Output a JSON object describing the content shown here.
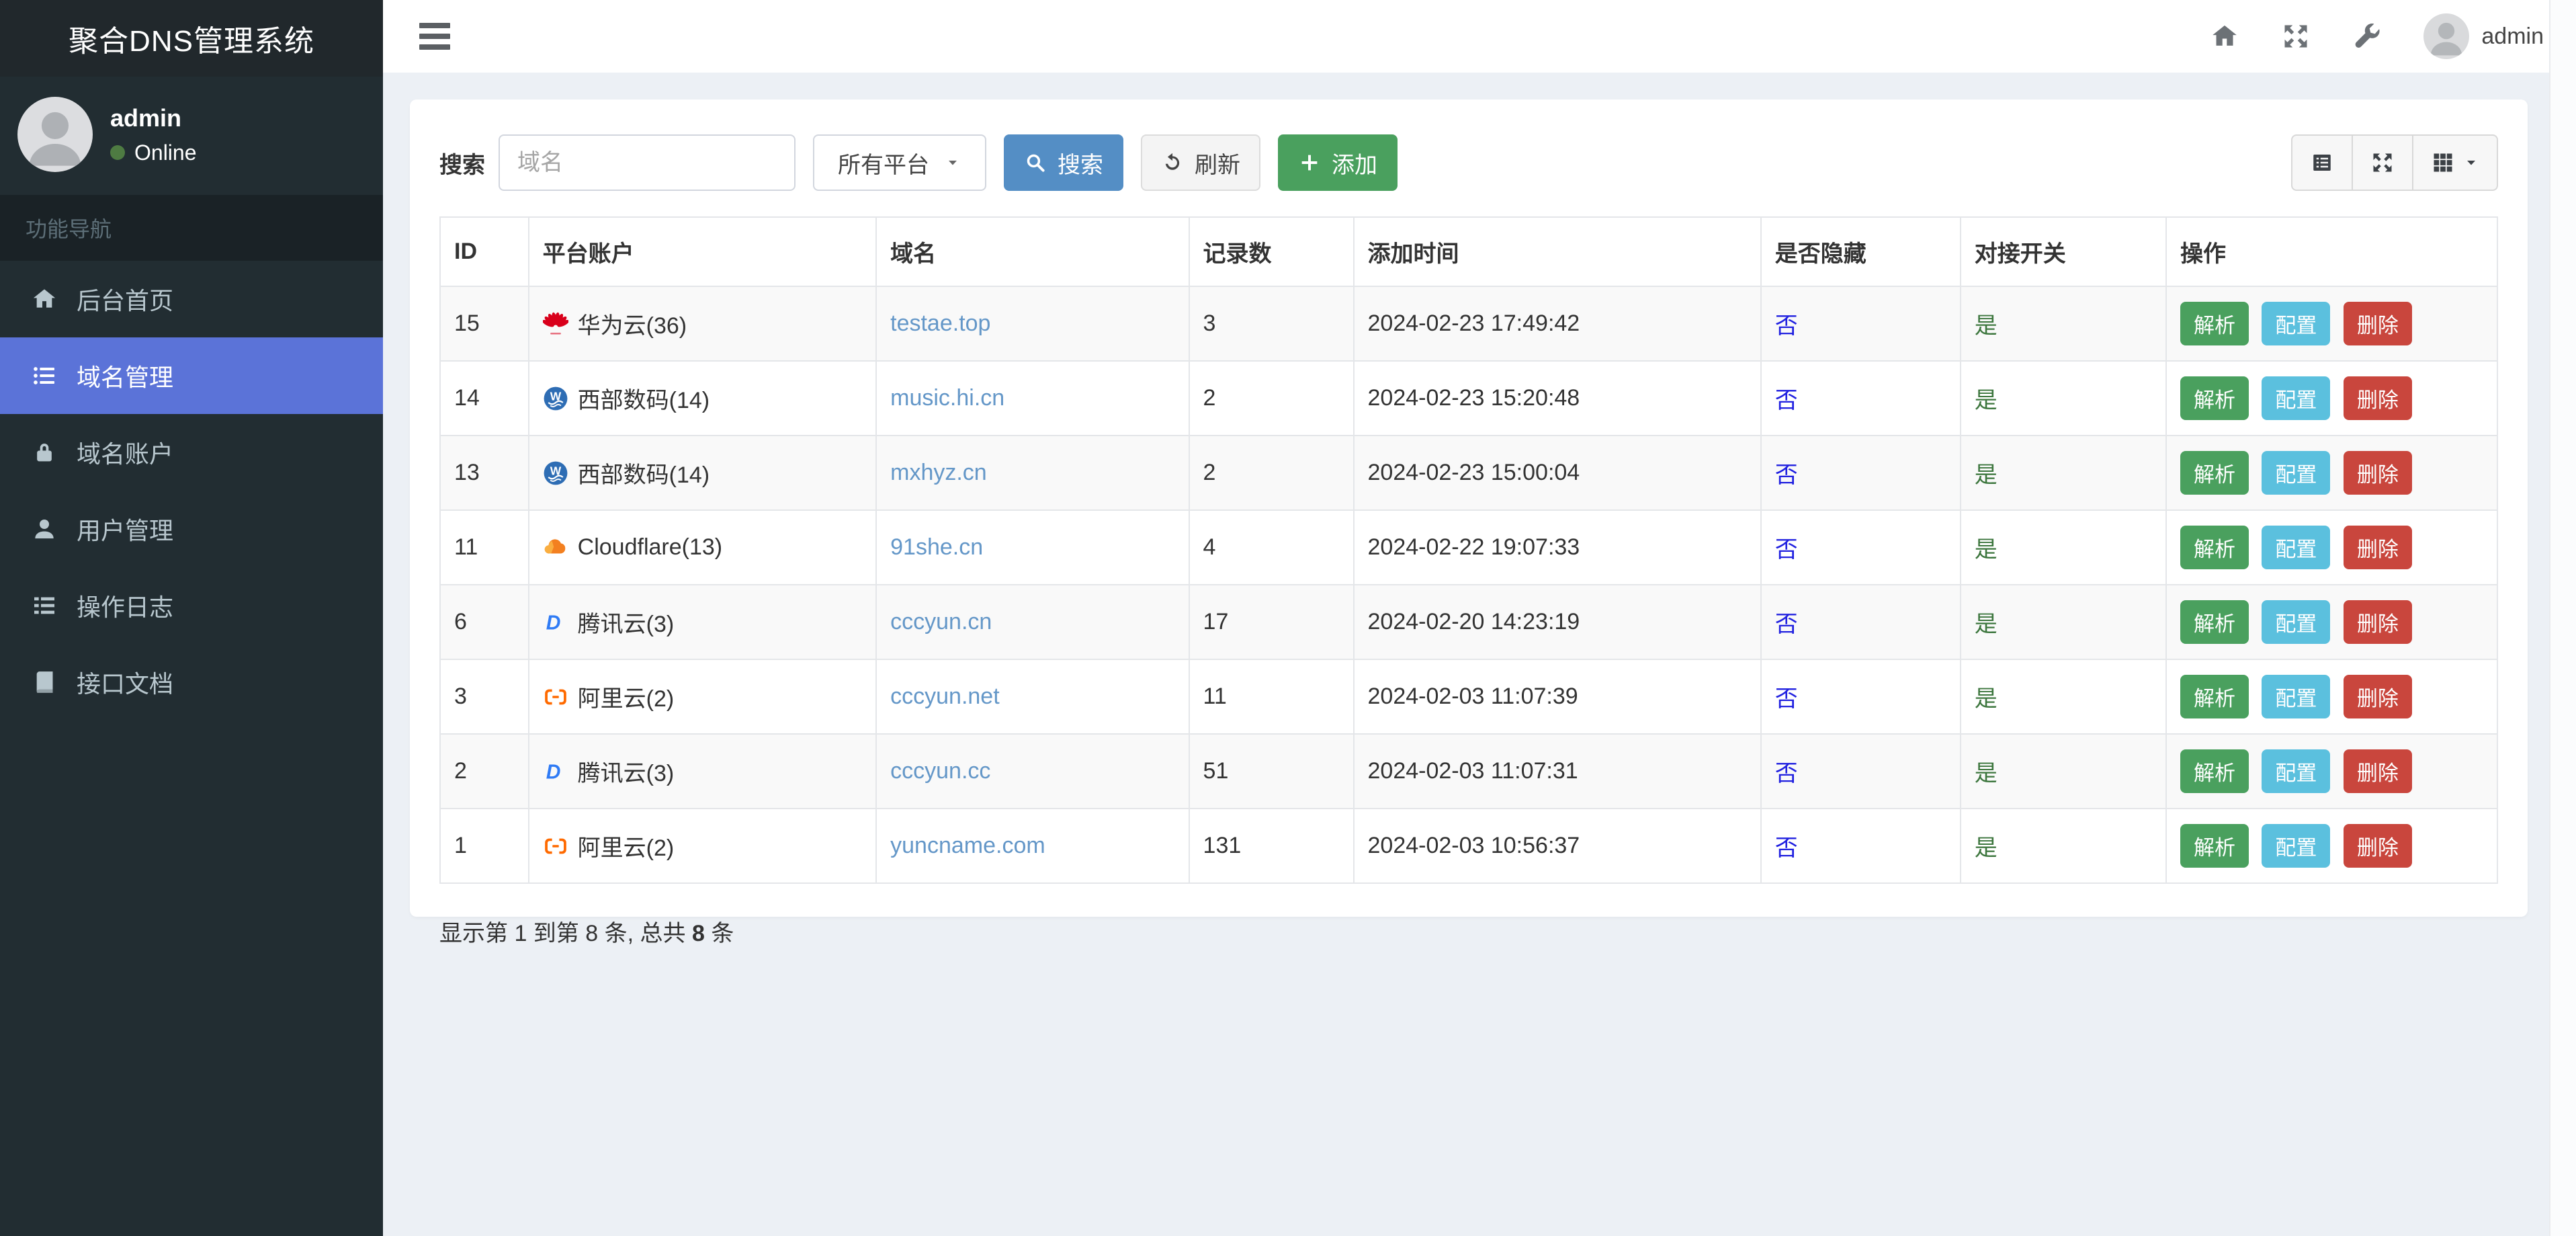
{
  "app": {
    "title": "聚合DNS管理系统"
  },
  "sidebar": {
    "user": {
      "name": "admin",
      "status": "Online"
    },
    "nav_header": "功能导航",
    "items": [
      {
        "label": "后台首页",
        "icon": "home-icon",
        "active": false
      },
      {
        "label": "域名管理",
        "icon": "list-icon",
        "active": true
      },
      {
        "label": "域名账户",
        "icon": "lock-icon",
        "active": false
      },
      {
        "label": "用户管理",
        "icon": "user-icon",
        "active": false
      },
      {
        "label": "操作日志",
        "icon": "log-icon",
        "active": false
      },
      {
        "label": "接口文档",
        "icon": "book-icon",
        "active": false
      }
    ]
  },
  "topbar": {
    "user_label": "admin"
  },
  "toolbar": {
    "search_label": "搜索",
    "search_placeholder": "域名",
    "platform_select_value": "所有平台",
    "search_button": "搜索",
    "refresh_button": "刷新",
    "add_button": "添加"
  },
  "table": {
    "columns": [
      "ID",
      "平台账户",
      "域名",
      "记录数",
      "添加时间",
      "是否隐藏",
      "对接开关",
      "操作"
    ],
    "action_labels": {
      "resolve": "解析",
      "config": "配置",
      "delete": "删除"
    },
    "rows": [
      {
        "id": "15",
        "platform": "华为云(36)",
        "platform_icon": "huawei",
        "domain": "testae.top",
        "records": "3",
        "added": "2024-02-23 17:49:42",
        "hidden": "否",
        "switch": "是"
      },
      {
        "id": "14",
        "platform": "西部数码(14)",
        "platform_icon": "west",
        "domain": "music.hi.cn",
        "records": "2",
        "added": "2024-02-23 15:20:48",
        "hidden": "否",
        "switch": "是"
      },
      {
        "id": "13",
        "platform": "西部数码(14)",
        "platform_icon": "west",
        "domain": "mxhyz.cn",
        "records": "2",
        "added": "2024-02-23 15:00:04",
        "hidden": "否",
        "switch": "是"
      },
      {
        "id": "11",
        "platform": "Cloudflare(13)",
        "platform_icon": "cloudflare",
        "domain": "91she.cn",
        "records": "4",
        "added": "2024-02-22 19:07:33",
        "hidden": "否",
        "switch": "是"
      },
      {
        "id": "6",
        "platform": "腾讯云(3)",
        "platform_icon": "tencent",
        "domain": "cccyun.cn",
        "records": "17",
        "added": "2024-02-20 14:23:19",
        "hidden": "否",
        "switch": "是"
      },
      {
        "id": "3",
        "platform": "阿里云(2)",
        "platform_icon": "aliyun",
        "domain": "cccyun.net",
        "records": "11",
        "added": "2024-02-03 11:07:39",
        "hidden": "否",
        "switch": "是"
      },
      {
        "id": "2",
        "platform": "腾讯云(3)",
        "platform_icon": "tencent",
        "domain": "cccyun.cc",
        "records": "51",
        "added": "2024-02-03 11:07:31",
        "hidden": "否",
        "switch": "是"
      },
      {
        "id": "1",
        "platform": "阿里云(2)",
        "platform_icon": "aliyun",
        "domain": "yuncname.com",
        "records": "131",
        "added": "2024-02-03 10:56:37",
        "hidden": "否",
        "switch": "是"
      }
    ],
    "summary_prefix": "显示第 1 到第 8 条, 总共 ",
    "summary_total": "8",
    "summary_suffix": " 条"
  },
  "colors": {
    "sidebar_bg": "#222d32",
    "content_bg": "#ecf0f5",
    "active_nav": "#5b73d8",
    "search_button": "#548ec5",
    "add_button": "#4aa05e",
    "resolve_button": "#4aa05e",
    "config_button": "#5bc0de",
    "delete_button": "#c9463d",
    "domain_link": "#6497c8",
    "hidden_no": "#2121e0",
    "switch_yes": "#3c763d",
    "online_dot": "#4e7b42"
  }
}
